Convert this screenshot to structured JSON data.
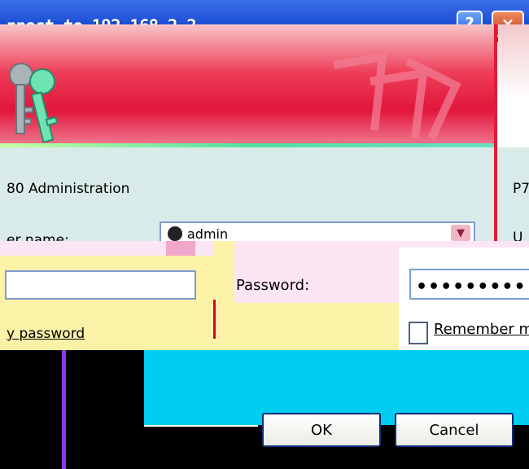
{
  "window": {
    "title": "nnect to 192.168.2.2",
    "help_label": "?",
    "close_label": "×"
  },
  "banner": {
    "logo_icon": "keys-icon"
  },
  "dialog": {
    "server_text": "80 Administration",
    "server_text_right": "P7",
    "username_label": "er name:",
    "username_label_right": "U",
    "username_value": "admin",
    "password_label": "Password:",
    "password_value": "•••••••••",
    "forgot_link": "y password",
    "remember_label": "Remember m",
    "ok_label": "OK",
    "cancel_label": "Cancel"
  },
  "colors": {
    "titlebar": "#1d4fd6",
    "banner_red": "#e2163c",
    "body_bg": "#d9ebe8",
    "corrupt_yellow": "#fbf2a8",
    "corrupt_cyan": "#00cdef",
    "corrupt_purple": "#8d37ee"
  }
}
